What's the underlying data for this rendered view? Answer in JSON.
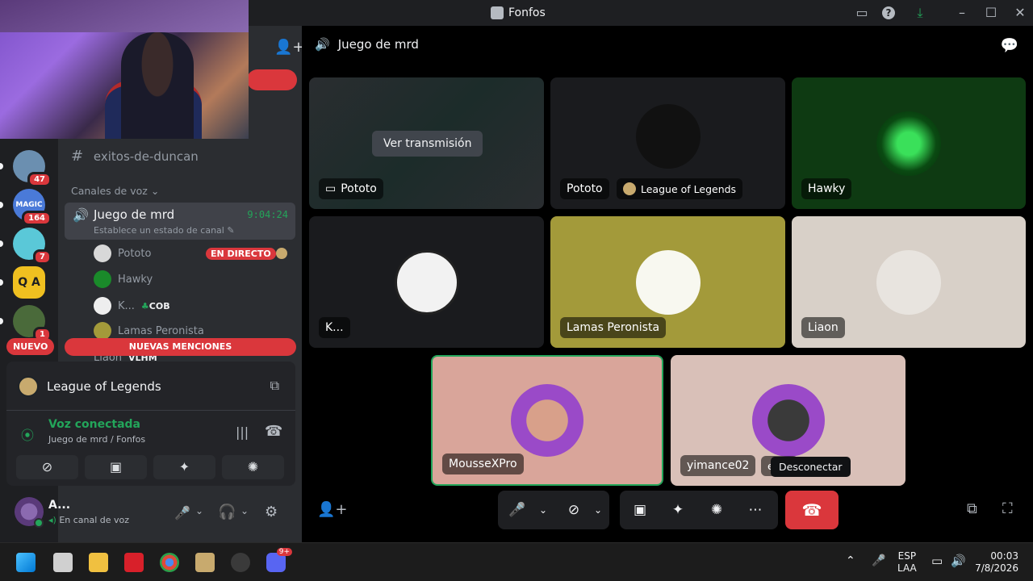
{
  "window": {
    "title": "Fonfos"
  },
  "rail": {
    "servers": [
      {
        "badge": "47",
        "color": "#6b8fb0"
      },
      {
        "badge": "164",
        "color": "#4a7ad8"
      },
      {
        "badge": "7",
        "color": "#5ac8d8"
      },
      {
        "badge": "",
        "color": "#f0c020"
      },
      {
        "badge": "1",
        "color": "#4a6a3a"
      }
    ],
    "magic_label": "MAGIC",
    "qa_label": "Q A"
  },
  "sidebar": {
    "text_channel": "exitos-de-duncan",
    "voice_category": "Canales de voz",
    "active_channel": {
      "name": "Juego de mrd",
      "timer": "9:04:24",
      "status": "Establece un estado de canal"
    },
    "voice_users": [
      {
        "name": "Pototo",
        "tag": "EN DIRECTO"
      },
      {
        "name": "Hawky",
        "tag": ""
      },
      {
        "name": "K...",
        "tag": "COB"
      },
      {
        "name": "Lamas Peronista",
        "tag": ""
      },
      {
        "name": "Liaon",
        "tag": "VLHM"
      }
    ],
    "new_label": "NUEVO",
    "mentions_label": "NUEVAS MENCIONES"
  },
  "voice_panel": {
    "game": "League of Legends",
    "connected": "Voz conectada",
    "location": "Juego de mrd / Fonfos"
  },
  "user": {
    "name": "A...",
    "status": "En canal de voz"
  },
  "main": {
    "channel": "Juego de mrd",
    "watch_label": "Ver transmisión",
    "tiles": [
      {
        "name": "Pototo",
        "game": "",
        "bg": "#2a2d30"
      },
      {
        "name": "Pototo",
        "game": "League of Legends",
        "bg": "#1a1b1e"
      },
      {
        "name": "Hawky",
        "game": "",
        "bg": "#0e3a12"
      },
      {
        "name": "K...",
        "game": "",
        "bg": "#1a1b1e"
      },
      {
        "name": "Lamas Peronista",
        "game": "",
        "bg": "#a39a3a"
      },
      {
        "name": "Liaon",
        "game": "",
        "bg": "#d8d0c8"
      },
      {
        "name": "MousseXPro",
        "game": "",
        "bg": "#d9a59a"
      },
      {
        "name": "yimance02",
        "game": "ends",
        "bg": "#d9c0b8"
      }
    ],
    "tooltip": "Desconectar"
  },
  "taskbar": {
    "lang_top": "ESP",
    "lang_bottom": "LAA",
    "time": "00:03",
    "date": "7/8/2026",
    "discord_badge": "9+"
  }
}
